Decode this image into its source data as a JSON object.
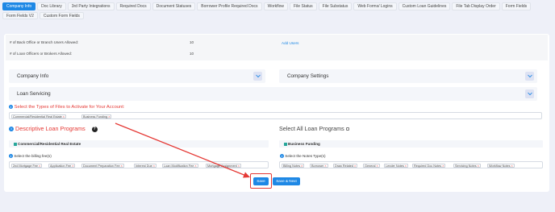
{
  "tabs": [
    {
      "label": "Company Info",
      "active": true
    },
    {
      "label": "Doc Library"
    },
    {
      "label": "3rd Party Integrations"
    },
    {
      "label": "Required Docs"
    },
    {
      "label": "Document Statuses"
    },
    {
      "label": "Borrower Profile Required Docs"
    },
    {
      "label": "Workflow"
    },
    {
      "label": "File Status"
    },
    {
      "label": "File Substatus"
    },
    {
      "label": "Web Forms/ Logins"
    },
    {
      "label": "Custom Loan Guidelines"
    },
    {
      "label": "File Tab Display Order"
    },
    {
      "label": "Form Fields"
    },
    {
      "label": "Form Fields V2"
    },
    {
      "label": "Custom Form Fields"
    }
  ],
  "users": {
    "back_office_label": "# of Back Office or Branch Users Allowed:",
    "back_office_value": "10",
    "loan_officers_label": "# of Loan Officers or Brokers Allowed:",
    "loan_officers_value": "10",
    "add_users": "Add Users"
  },
  "sections": {
    "company_info": "Company Info",
    "company_settings": "Company Settings",
    "loan_servicing": "Loan Servicing"
  },
  "file_types": {
    "title": "Select the Types of Files to Activate for Your Account:",
    "selected": [
      "Commercial/Residential Real Estate",
      "Business Funding"
    ]
  },
  "descriptive": {
    "title": "Descriptive Loan Programs",
    "help": "?",
    "select_all": "Select All Loan Programs"
  },
  "left_program": {
    "name": "Commercial/Residential Real Estate",
    "fees_label": "Select the billing fee(s)",
    "fees": [
      "2nd Mortgage Fee",
      "Application Fee",
      "Document Preparation Fee",
      "Interest Due",
      "Loan Modification Fee",
      "Mortgage Assignment"
    ]
  },
  "right_program": {
    "name": "Business Funding",
    "notes_label": "Select the Notes Type(s)",
    "notes": [
      "Billing Notes",
      "Borrower",
      "Draw Related",
      "General",
      "Lender Notes",
      "Required Doc Notes",
      "Servicing Notes",
      "Workflow Notes"
    ]
  },
  "buttons": {
    "save": "Save",
    "save_next": "Save & Next"
  },
  "colors": {
    "accent": "#1e88e5",
    "highlight": "#e53935",
    "text_red": "#e53935"
  }
}
